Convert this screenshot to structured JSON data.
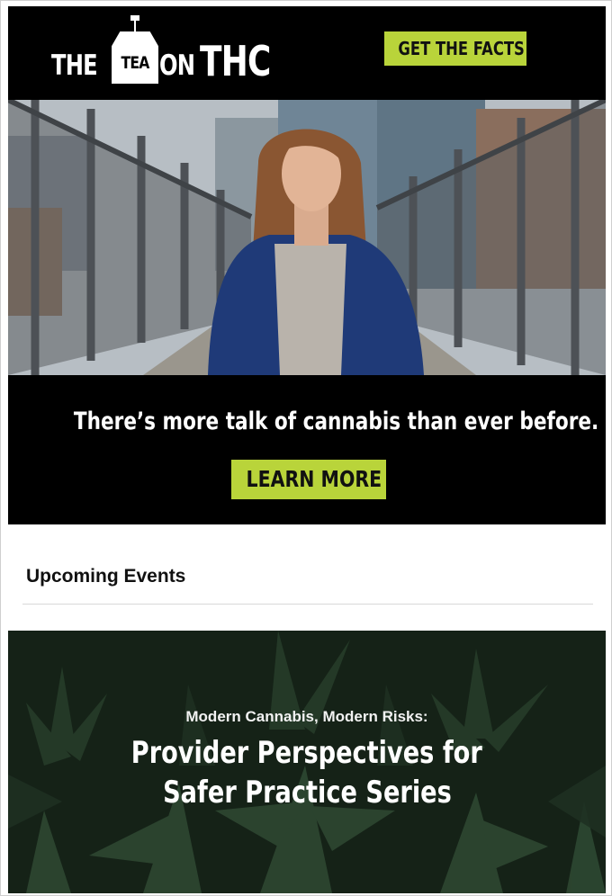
{
  "header": {
    "logo": {
      "word_the": "THE",
      "word_tea": "TEA",
      "word_on": "ON",
      "word_thc": "THC"
    },
    "cta_label": "GET THE FACTS"
  },
  "hero": {
    "image": "young-woman-on-pedestrian-bridge-photo"
  },
  "band": {
    "headline": "There’s more talk of cannabis than ever before.",
    "cta_label": "LEARN MORE"
  },
  "events": {
    "title": "Upcoming Events"
  },
  "banner": {
    "image": "cannabis-leaves-background",
    "kicker": "Modern Cannabis, Modern Risks:",
    "title_line1": "Provider Perspectives for",
    "title_line2": "Safer Practice Series"
  },
  "colors": {
    "accent_green": "#b9d43a",
    "black": "#000000",
    "white": "#ffffff"
  }
}
